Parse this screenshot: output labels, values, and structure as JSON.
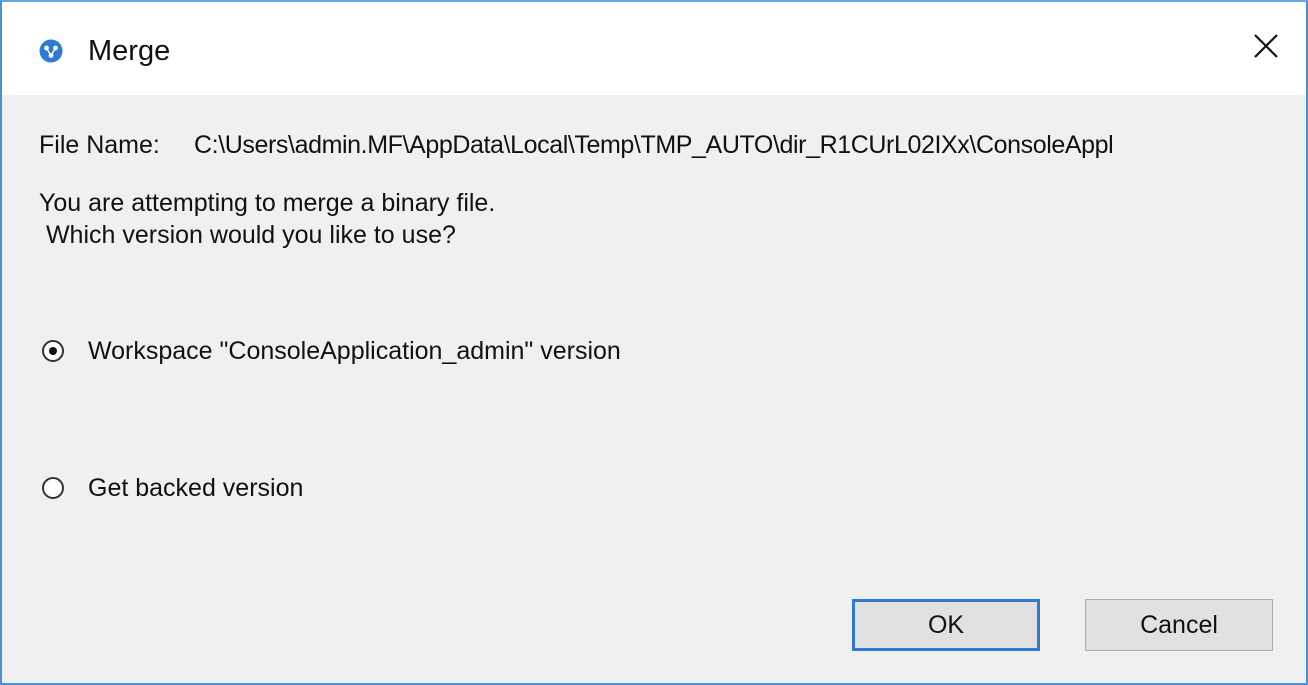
{
  "window": {
    "title": "Merge",
    "close_glyph": "✕",
    "app_icon": "merge-app-icon",
    "accent_color": "#2c7ad6"
  },
  "file": {
    "label": "File Name:",
    "path": "C:\\Users\\admin.MF\\AppData\\Local\\Temp\\TMP_AUTO\\dir_R1CUrL02IXx\\ConsoleAppl"
  },
  "message": {
    "line1": "You are attempting to merge a binary file.",
    "line2": " Which version would you like to use?"
  },
  "options": [
    {
      "label": "Workspace \"ConsoleApplication_admin\" version",
      "checked": true
    },
    {
      "label": "Get backed version",
      "checked": false
    }
  ],
  "buttons": {
    "ok": "OK",
    "cancel": "Cancel"
  }
}
